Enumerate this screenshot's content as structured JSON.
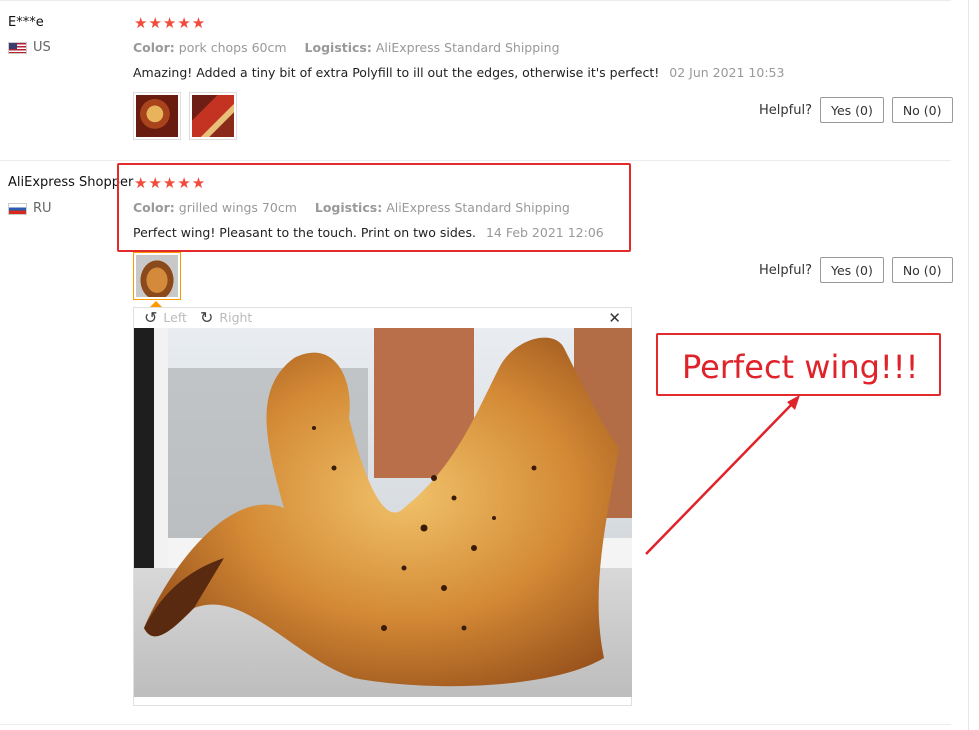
{
  "reviews": [
    {
      "user": "E***e",
      "country": "US",
      "stars": "★★★★★",
      "color_label": "Color:",
      "color_value": "pork chops 60cm",
      "logistics_label": "Logistics:",
      "logistics_value": "AliExpress Standard Shipping",
      "text": "Amazing! Added a tiny bit of extra Polyfill to ill out the edges, otherwise it's perfect!",
      "date": "02 Jun 2021 10:53",
      "helpful_label": "Helpful?",
      "yes_label": "Yes (0)",
      "no_label": "No (0)"
    },
    {
      "user": "AliExpress Shopper",
      "country": "RU",
      "stars": "★★★★★",
      "color_label": "Color:",
      "color_value": "grilled wings 70cm",
      "logistics_label": "Logistics:",
      "logistics_value": "AliExpress Standard Shipping",
      "text": "Perfect wing! Pleasant to the touch. Print on two sides.",
      "date": "14 Feb 2021 12:06",
      "helpful_label": "Helpful?",
      "yes_label": "Yes (0)",
      "no_label": "No (0)"
    }
  ],
  "viewer": {
    "rotate_left_label": "Left",
    "rotate_right_label": "Right",
    "close_glyph": "✕"
  },
  "annotation": {
    "text": "Perfect wing!!!",
    "color": "#e0232b"
  },
  "colors": {
    "star": "#f04b3b",
    "active_thumb": "#ff9900",
    "highlight_box": "#e32b2b"
  },
  "icons": {
    "rotate_left": "↺",
    "rotate_right": "↻"
  }
}
